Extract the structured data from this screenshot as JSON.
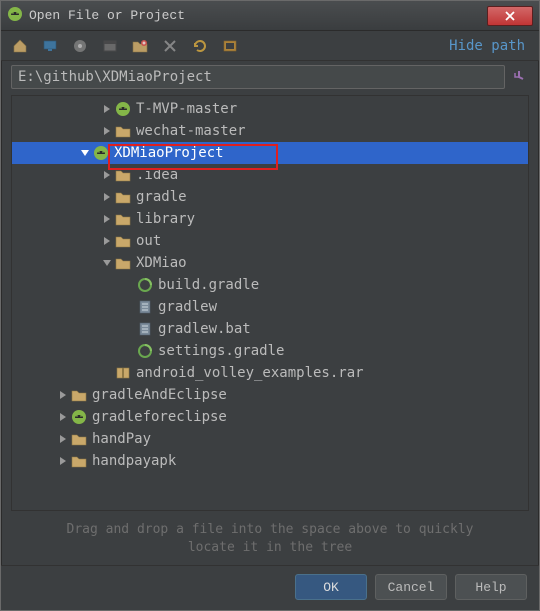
{
  "window": {
    "title": "Open File or Project"
  },
  "toolbar": {
    "hide_path": "Hide path"
  },
  "path": {
    "value": "E:\\github\\XDMiaoProject"
  },
  "tree": {
    "nodes": [
      {
        "depth": 4,
        "arrow": "right",
        "icon": "android",
        "label": "T-MVP-master"
      },
      {
        "depth": 4,
        "arrow": "right",
        "icon": "folder",
        "label": "wechat-master"
      },
      {
        "depth": 3,
        "arrow": "down",
        "icon": "android",
        "label": "XDMiaoProject",
        "selected": true
      },
      {
        "depth": 4,
        "arrow": "right",
        "icon": "folder",
        "label": ".idea"
      },
      {
        "depth": 4,
        "arrow": "right",
        "icon": "folder",
        "label": "gradle"
      },
      {
        "depth": 4,
        "arrow": "right",
        "icon": "folder",
        "label": "library"
      },
      {
        "depth": 4,
        "arrow": "right",
        "icon": "folder",
        "label": "out"
      },
      {
        "depth": 4,
        "arrow": "down",
        "icon": "folder",
        "label": "XDMiao"
      },
      {
        "depth": 5,
        "arrow": "none",
        "icon": "gradle",
        "label": "build.gradle"
      },
      {
        "depth": 5,
        "arrow": "none",
        "icon": "file",
        "label": "gradlew"
      },
      {
        "depth": 5,
        "arrow": "none",
        "icon": "file",
        "label": "gradlew.bat"
      },
      {
        "depth": 5,
        "arrow": "none",
        "icon": "gradle",
        "label": "settings.gradle"
      },
      {
        "depth": 4,
        "arrow": "none",
        "icon": "archive",
        "label": "android_volley_examples.rar"
      },
      {
        "depth": 2,
        "arrow": "right",
        "icon": "folder",
        "label": "gradleAndEclipse"
      },
      {
        "depth": 2,
        "arrow": "right",
        "icon": "android",
        "label": "gradleforeclipse"
      },
      {
        "depth": 2,
        "arrow": "right",
        "icon": "folder",
        "label": "handPay"
      },
      {
        "depth": 2,
        "arrow": "right",
        "icon": "folder",
        "label": "handpayapk"
      }
    ]
  },
  "hint": {
    "line1": "Drag and drop a file into the space above to quickly",
    "line2": "locate it in the tree"
  },
  "buttons": {
    "ok": "OK",
    "cancel": "Cancel",
    "help": "Help"
  }
}
